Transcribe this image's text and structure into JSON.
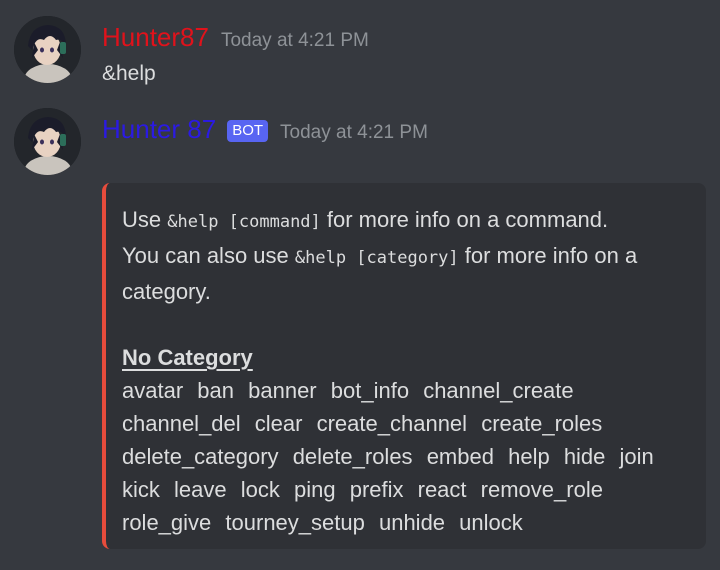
{
  "messages": [
    {
      "username": "Hunter87",
      "timestamp": "Today at 4:21 PM",
      "content": "&help"
    },
    {
      "username": "Hunter 87",
      "badge": "BOT",
      "timestamp": "Today at 4:21 PM",
      "embed": {
        "accent_color": "#e74c3c",
        "line1_pre": "Use ",
        "line1_code": "&help [command]",
        "line1_post": " for more info on a command.",
        "line2_pre": "You can also use ",
        "line2_code": "&help [category]",
        "line2_post": " for more info on a category.",
        "field_title": "No Category",
        "commands": [
          "avatar",
          "ban",
          "banner",
          "bot_info",
          "channel_create",
          "channel_del",
          "clear",
          "create_channel",
          "create_roles",
          "delete_category",
          "delete_roles",
          "embed",
          "help",
          "hide",
          "join",
          "kick",
          "leave",
          "lock",
          "ping",
          "prefix",
          "react",
          "remove_role",
          "role_give",
          "tourney_setup",
          "unhide",
          "unlock"
        ]
      }
    }
  ],
  "colors": {
    "background": "#36393f",
    "embed_background": "#2f3136",
    "username_user": "#e0121b",
    "username_bot": "#2b1ae3",
    "bot_badge": "#5865f2",
    "timestamp": "#8e9297"
  }
}
